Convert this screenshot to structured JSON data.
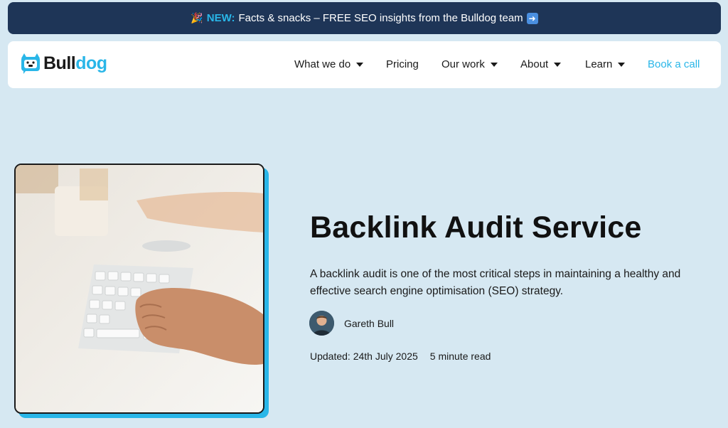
{
  "announcement": {
    "badge": "NEW:",
    "text": "Facts & snacks – FREE SEO insights from the Bulldog team",
    "icon_left": "party-popper-icon",
    "icon_right": "arrow-right-icon"
  },
  "brand": {
    "name_part1": "Bull",
    "name_part2": "dog",
    "logo_icon": "bulldog-logo-icon",
    "accent_color": "#29b6e8",
    "dark_color": "#1e3557"
  },
  "nav": {
    "items": [
      {
        "label": "What we do",
        "dropdown": true
      },
      {
        "label": "Pricing",
        "dropdown": false
      },
      {
        "label": "Our work",
        "dropdown": true
      },
      {
        "label": "About",
        "dropdown": true
      },
      {
        "label": "Learn",
        "dropdown": true
      }
    ],
    "cta": "Book a call"
  },
  "hero": {
    "title": "Backlink Audit Service",
    "description": "A backlink audit is one of the most critical steps in maintaining a healthy and effective search engine optimisation (SEO) strategy.",
    "author": "Gareth Bull",
    "updated": "Updated: 24th July 2025",
    "read_time": "5 minute read"
  }
}
